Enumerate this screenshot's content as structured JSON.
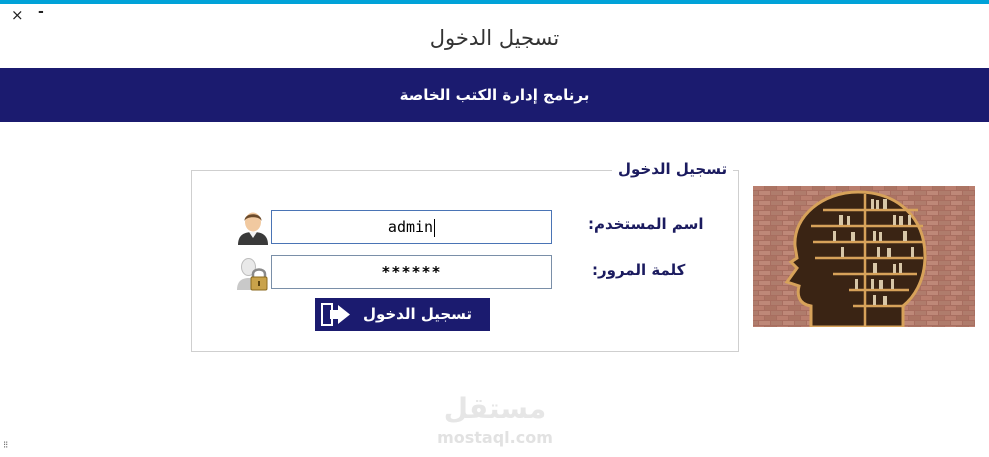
{
  "window": {
    "close_glyph": "×",
    "minimize_glyph": "-",
    "title": "تسجيل الدخول",
    "accent_color": "#00a2d8"
  },
  "banner": {
    "text": "برنامج إدارة الكتب الخاصة",
    "background": "#1b1b6f"
  },
  "login_panel": {
    "legend": "تسجيل الدخول",
    "username_label": "اسم المستخدم:",
    "username_value": "admin",
    "password_label": "كلمة المرور:",
    "password_value": "******",
    "submit_label": "تسجيل الدخول"
  },
  "icons": {
    "user": "user-icon",
    "password": "lock-user-icon",
    "login": "login-arrow-icon"
  },
  "watermark": {
    "arabic": "مستقل",
    "latin": "mostaql.com"
  },
  "status": {
    "grip": "⁝⁝"
  }
}
